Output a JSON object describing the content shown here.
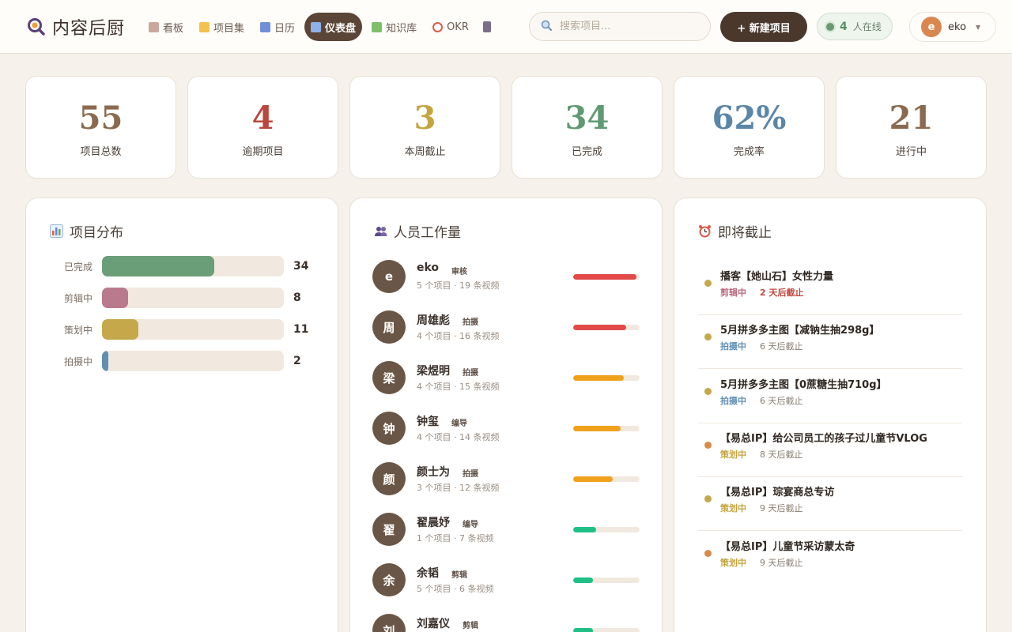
{
  "app": {
    "title": "内容后厨",
    "logo_icon": "magnifier-logo-icon"
  },
  "nav": [
    {
      "label": "看板",
      "icon": "clipboard-icon",
      "color": "#c9a79a",
      "active": false
    },
    {
      "label": "项目集",
      "icon": "folder-icon",
      "color": "#f2c14e",
      "active": false
    },
    {
      "label": "日历",
      "icon": "calendar-icon",
      "color": "#6f8fd8",
      "active": false
    },
    {
      "label": "仪表盘",
      "icon": "bar-chart-icon",
      "color": "#8fb0e8",
      "active": true
    },
    {
      "label": "知识库",
      "icon": "books-icon",
      "color": "#7fbf6a",
      "active": false
    },
    {
      "label": "OKR",
      "icon": "target-icon",
      "color": "#e05a4a",
      "active": false
    }
  ],
  "search": {
    "placeholder": "搜索项目..."
  },
  "new_project_label": "+ 新建项目",
  "online": {
    "count": "4",
    "label": "人在线"
  },
  "user": {
    "initial": "e",
    "name": "eko"
  },
  "stats": [
    {
      "value": "55",
      "label": "项目总数",
      "color": "#8a6a4e"
    },
    {
      "value": "4",
      "label": "逾期项目",
      "color": "#b9473d"
    },
    {
      "value": "3",
      "label": "本周截止",
      "color": "#c4a43f"
    },
    {
      "value": "34",
      "label": "已完成",
      "color": "#5f9a72"
    },
    {
      "value": "62%",
      "label": "完成率",
      "color": "#5a86a8"
    },
    {
      "value": "21",
      "label": "进行中",
      "color": "#8a6a4e"
    }
  ],
  "distribution": {
    "title": "项目分布",
    "total_scale": 55,
    "items": [
      {
        "label": "已完成",
        "count": 34,
        "color": "#6a9e78"
      },
      {
        "label": "剪辑中",
        "count": 8,
        "color": "#b97a8e"
      },
      {
        "label": "策划中",
        "count": 11,
        "color": "#c5a84a"
      },
      {
        "label": "拍摄中",
        "count": 2,
        "color": "#5f8fb2"
      }
    ]
  },
  "workload": {
    "title": "人员工作量",
    "people": [
      {
        "initial": "e",
        "name": "eko",
        "role": "审核",
        "meta": "5 个项目 · 19 条视频",
        "load": 0.95,
        "color": "#e24a4a"
      },
      {
        "initial": "周",
        "name": "周雄彪",
        "role": "拍摄",
        "meta": "4 个项目 · 16 条视频",
        "load": 0.8,
        "color": "#e24a4a"
      },
      {
        "initial": "梁",
        "name": "梁煜明",
        "role": "拍摄",
        "meta": "4 个项目 · 15 条视频",
        "load": 0.76,
        "color": "#f0a11c"
      },
      {
        "initial": "钟",
        "name": "钟玺",
        "role": "编导",
        "meta": "4 个项目 · 14 条视频",
        "load": 0.71,
        "color": "#f0a11c"
      },
      {
        "initial": "颜",
        "name": "颜士为",
        "role": "拍摄",
        "meta": "3 个项目 · 12 条视频",
        "load": 0.6,
        "color": "#f0a11c"
      },
      {
        "initial": "翟",
        "name": "翟晨妤",
        "role": "编导",
        "meta": "1 个项目 · 7 条视频",
        "load": 0.35,
        "color": "#1fbf86"
      },
      {
        "initial": "余",
        "name": "余韬",
        "role": "剪辑",
        "meta": "5 个项目 · 6 条视频",
        "load": 0.3,
        "color": "#1fbf86"
      },
      {
        "initial": "刘",
        "name": "刘嘉仪",
        "role": "剪辑",
        "meta": "",
        "load": 0.3,
        "color": "#1fbf86"
      }
    ]
  },
  "deadlines": {
    "title": "即将截止",
    "items": [
      {
        "title": "播客【她山石】女性力量",
        "status": "剪辑中",
        "status_color": "#b9677e",
        "due": "2 天后截止",
        "urgent": true,
        "dot_color": "#c5a84a"
      },
      {
        "title": "5月拼多多主图【减钠生抽298g】",
        "status": "拍摄中",
        "status_color": "#5f8fb2",
        "due": "6 天后截止",
        "urgent": false,
        "dot_color": "#c5a84a"
      },
      {
        "title": "5月拼多多主图【0蔗糖生抽710g】",
        "status": "拍摄中",
        "status_color": "#5f8fb2",
        "due": "6 天后截止",
        "urgent": false,
        "dot_color": "#c5a84a"
      },
      {
        "title": "【易总IP】给公司员工的孩子过儿童节VLOG",
        "status": "策划中",
        "status_color": "#c5a43f",
        "due": "8 天后截止",
        "urgent": false,
        "dot_color": "#d98a4a"
      },
      {
        "title": "【易总IP】琮宴商总专访",
        "status": "策划中",
        "status_color": "#c5a43f",
        "due": "9 天后截止",
        "urgent": false,
        "dot_color": "#c5a84a"
      },
      {
        "title": "【易总IP】儿童节采访蒙太奇",
        "status": "策划中",
        "status_color": "#c5a43f",
        "due": "9 天后截止",
        "urgent": false,
        "dot_color": "#d98a4a"
      }
    ]
  }
}
